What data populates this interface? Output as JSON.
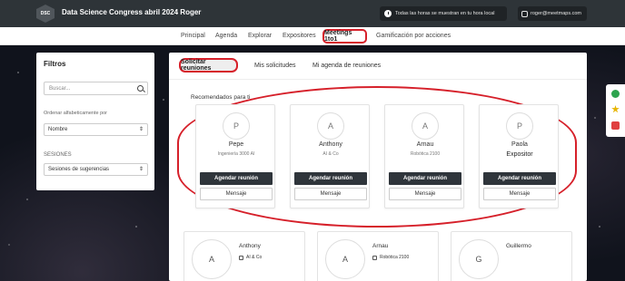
{
  "header": {
    "logo_text": "DSC",
    "title": "Data Science Congress abril 2024 Roger",
    "timezone_notice": "Todas las horas se muestran en tu hora local",
    "user_email": "roger@meetmaps.com"
  },
  "nav": {
    "items": [
      "Principal",
      "Agenda",
      "Explorar",
      "Expositores",
      "Meetings 1to1",
      "Gamificación por acciones"
    ],
    "active": "Meetings 1to1"
  },
  "filters": {
    "title": "Filtros",
    "search_placeholder": "Buscar...",
    "sort_label": "Ordenar alfabeticamente por",
    "sort_value": "Nombre",
    "sessions_label": "SESIONES",
    "sessions_value": "Sesiones de sugerencias"
  },
  "tabs": {
    "items": [
      "Solicitar reuniones",
      "Mis solicitudes",
      "Mi agenda de reuniones"
    ],
    "active": "Solicitar reuniones"
  },
  "recommended": {
    "title": "Recomendados para ti",
    "cards": [
      {
        "initial": "P",
        "name": "Pepe",
        "org": "Ingeniería 3000 AI",
        "schedule": "Agendar reunión",
        "message": "Mensaje"
      },
      {
        "initial": "A",
        "name": "Anthony",
        "org": "AI & Co",
        "schedule": "Agendar reunión",
        "message": "Mensaje"
      },
      {
        "initial": "A",
        "name": "Arnau",
        "org": "Robótica 2100",
        "schedule": "Agendar reunión",
        "message": "Mensaje"
      },
      {
        "initial": "P",
        "name": "Paola",
        "role": "Expositor",
        "schedule": "Agendar reunión",
        "message": "Mensaje"
      }
    ]
  },
  "list": [
    {
      "initial": "A",
      "name": "Anthony",
      "org": "AI & Co"
    },
    {
      "initial": "A",
      "name": "Arnau",
      "org": "Robótica 2100"
    },
    {
      "initial": "G",
      "name": "Guillermo",
      "org": ""
    }
  ],
  "side_icons": [
    "chat-icon",
    "star-icon",
    "gamepad-icon"
  ],
  "colors": {
    "highlight": "#d6202a",
    "dark_button": "#2f353b",
    "topbar": "#2e3438"
  }
}
